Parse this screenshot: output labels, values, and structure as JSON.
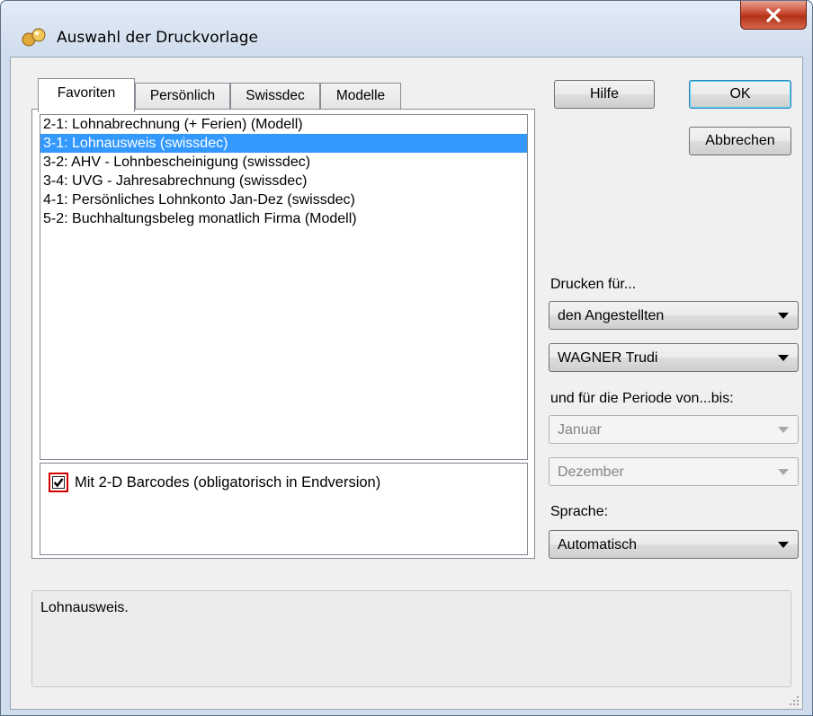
{
  "window": {
    "title": "Auswahl der Druckvorlage",
    "close_glyph": "✕"
  },
  "tabs": [
    {
      "label": "Favoriten",
      "active": true
    },
    {
      "label": "Persönlich",
      "active": false
    },
    {
      "label": "Swissdec",
      "active": false
    },
    {
      "label": "Modelle",
      "active": false
    }
  ],
  "templates": [
    {
      "label": "2-1: Lohnabrechnung (+ Ferien) (Modell)",
      "selected": false
    },
    {
      "label": "3-1: Lohnausweis (swissdec)",
      "selected": true
    },
    {
      "label": "3-2: AHV - Lohnbescheinigung (swissdec)",
      "selected": false
    },
    {
      "label": "3-4: UVG - Jahresabrechnung (swissdec)",
      "selected": false
    },
    {
      "label": "4-1: Persönliches Lohnkonto Jan-Dez (swissdec)",
      "selected": false
    },
    {
      "label": "5-2: Buchhaltungsbeleg monatlich Firma (Modell)",
      "selected": false
    }
  ],
  "barcode": {
    "label": "Mit 2-D Barcodes (obligatorisch in Endversion)",
    "checked": true
  },
  "buttons": {
    "help": "Hilfe",
    "ok": "OK",
    "cancel": "Abbrechen"
  },
  "print_for": {
    "label": "Drucken für...",
    "type_value": "den Angestellten",
    "employee_value": "WAGNER Trudi"
  },
  "period": {
    "label": "und für die Periode von...bis:",
    "from_value": "Januar",
    "to_value": "Dezember"
  },
  "language": {
    "label": "Sprache:",
    "value": "Automatisch"
  },
  "description": "Lohnausweis.",
  "colors": {
    "selection": "#3399ff",
    "checkbox_highlight": "#d40000",
    "close_button": "#c9472f"
  }
}
